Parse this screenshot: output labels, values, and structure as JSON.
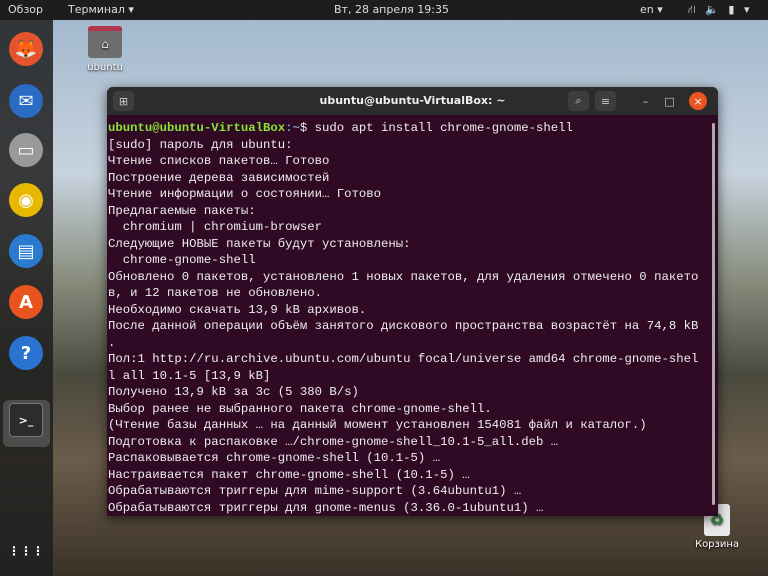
{
  "topbar": {
    "activities": "Обзор",
    "app_menu": "Терминал ▾",
    "clock": "Вт, 28 апреля  19:35",
    "lang": "en ▾",
    "status_icons": "⛙ 🔈 ▮ ▾"
  },
  "dock": {
    "apps": [
      {
        "name": "firefox",
        "glyph": "🦊",
        "color": "#e5542c"
      },
      {
        "name": "thunderbird",
        "glyph": "✉",
        "color": "#2a6bc4"
      },
      {
        "name": "files",
        "glyph": "▭",
        "color": "#9a9a9a"
      },
      {
        "name": "rhythmbox",
        "glyph": "◉",
        "color": "#e8b800"
      },
      {
        "name": "writer",
        "glyph": "▤",
        "color": "#2a7ad0"
      },
      {
        "name": "software",
        "glyph": "A",
        "color": "#e9541e"
      },
      {
        "name": "help",
        "glyph": "?",
        "color": "#2b73d1"
      },
      {
        "name": "terminal",
        "glyph": ">_",
        "color": "#2c2c2c"
      }
    ],
    "show_apps": "⋮⋮⋮"
  },
  "desktop": {
    "home_label": "ubuntu",
    "trash_label": "Корзина"
  },
  "window": {
    "title": "ubuntu@ubuntu-VirtualBox: ~",
    "new_tab": "⊞",
    "search": "⌕",
    "menu": "≡",
    "minimize": "–",
    "maximize": "□",
    "close": "×"
  },
  "terminal": {
    "prompt_user": "ubuntu@ubuntu-VirtualBox",
    "prompt_path": ":~",
    "command": "$ sudo apt install chrome-gnome-shell",
    "lines": [
      "[sudo] пароль для ubuntu:",
      "Чтение списков пакетов… Готово",
      "Построение дерева зависимостей",
      "Чтение информации о состоянии… Готово",
      "Предлагаемые пакеты:",
      "  chromium | chromium-browser",
      "Следующие НОВЫЕ пакеты будут установлены:",
      "  chrome-gnome-shell",
      "Обновлено 0 пакетов, установлено 1 новых пакетов, для удаления отмечено 0 пакето",
      "в, и 12 пакетов не обновлено.",
      "Необходимо скачать 13,9 kB архивов.",
      "После данной операции объём занятого дискового пространства возрастёт на 74,8 kB",
      ".",
      "Пол:1 http://ru.archive.ubuntu.com/ubuntu focal/universe amd64 chrome-gnome-shel",
      "l all 10.1-5 [13,9 kB]",
      "Получено 13,9 kB за 3c (5 380 B/s)",
      "Выбор ранее не выбранного пакета chrome-gnome-shell.",
      "(Чтение базы данных … на данный момент установлен 154081 файл и каталог.)",
      "Подготовка к распаковке …/chrome-gnome-shell_10.1-5_all.deb …",
      "Распаковывается chrome-gnome-shell (10.1-5) …",
      "Настраивается пакет chrome-gnome-shell (10.1-5) …",
      "Обрабатываются триггеры для mime-support (3.64ubuntu1) …",
      "Обрабатываются триггеры для gnome-menus (3.36.0-1ubuntu1) …"
    ]
  }
}
